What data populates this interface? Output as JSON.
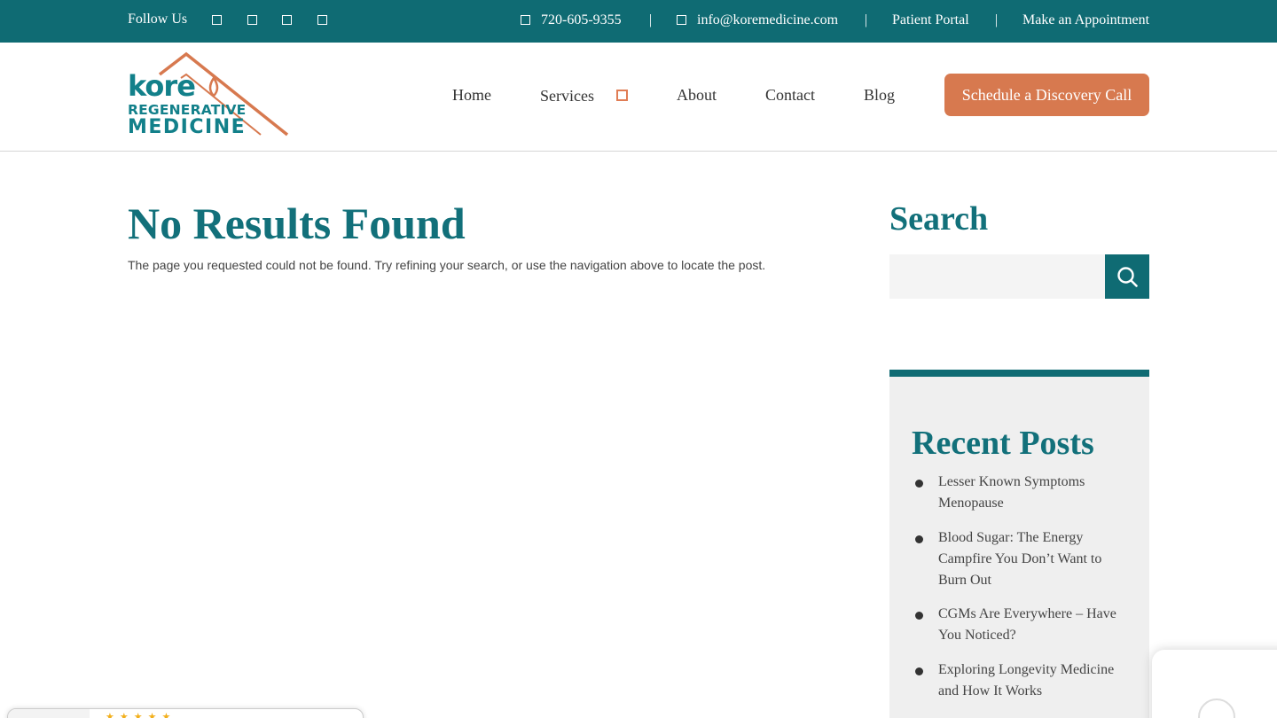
{
  "topbar": {
    "follow_label": "Follow Us",
    "social_icons": [
      "facebook-icon",
      "instagram-icon",
      "linkedin-icon",
      "youtube-icon"
    ],
    "phone": "720-605-9355",
    "email": "info@koremedicine.com",
    "separator": "|",
    "patient_portal": "Patient Portal",
    "appointment": "Make an Appointment"
  },
  "logo": {
    "line1": "kore",
    "line2": "REGENERATIVE",
    "line3": "MEDICINE"
  },
  "nav": {
    "items": [
      "Home",
      "Services",
      "About",
      "Contact",
      "Blog"
    ],
    "cta": "Schedule a Discovery Call"
  },
  "main": {
    "title": "No Results Found",
    "message": "The page you requested could not be found. Try refining your search, or use the navigation above to locate the post."
  },
  "sidebar": {
    "search_title": "Search",
    "search_placeholder": "",
    "recent_title": "Recent Posts",
    "posts": [
      "Lesser Known Symptoms Menopause",
      "Blood Sugar: The Energy Campfire You Don’t Want to Burn Out",
      "CGMs Are Everywhere – Have You Noticed?",
      "Exploring Longevity Medicine and How It Works"
    ]
  },
  "colors": {
    "brand_teal": "#0f6b73",
    "accent_orange": "#d7794f"
  }
}
